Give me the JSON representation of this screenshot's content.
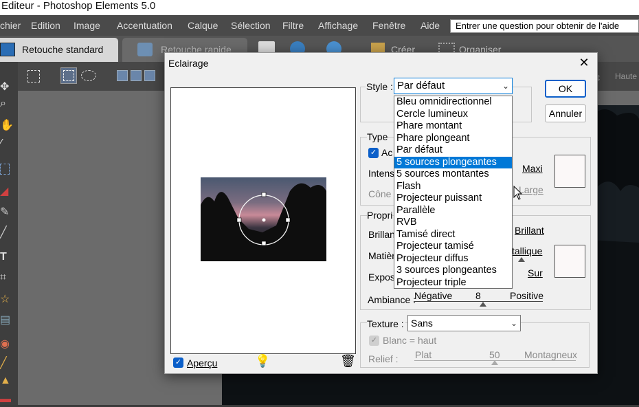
{
  "app": {
    "title": "Editeur - Photoshop Elements 5.0"
  },
  "menu": [
    "chier",
    "Edition",
    "Image",
    "Accentuation",
    "Calque",
    "Sélection",
    "Filtre",
    "Affichage",
    "Fenêtre",
    "Aide"
  ],
  "help_search": {
    "placeholder": "Entrer une question pour obtenir de l'aide"
  },
  "tabs": {
    "standard": "Retouche standard",
    "quick": "Retouche rapide"
  },
  "toolbar": {
    "create": "Créer",
    "organize": "Organiser"
  },
  "right_panel_label": "Haute",
  "dialog": {
    "title": "Eclairage",
    "close_glyph": "✕",
    "preview_label": "Aperçu",
    "preview_checked": true,
    "style_label": "Style :",
    "style_value": "Par défaut",
    "ok": "OK",
    "cancel": "Annuler",
    "type_group": "Type",
    "type_check_label": "Ac",
    "intensity_label": "Intens",
    "intensity_max": "Maxi",
    "cone_label": "Cône",
    "cone_max": "Large",
    "props_group": "Propri",
    "brillance_label": "Brillan",
    "brillance_max": "Brillant",
    "matiere_label": "Matièr",
    "matiere_max": "tallique",
    "expo_label": "Expos",
    "expo_max": "Sur",
    "ambiance_label": "Ambiance :",
    "ambiance_min": "Négative",
    "ambiance_value": "8",
    "ambiance_max": "Positive",
    "texture_label": "Texture :",
    "texture_value": "Sans",
    "blanc_label": "Blanc = haut",
    "relief_label": "Relief :",
    "relief_min": "Plat",
    "relief_value": "50",
    "relief_max": "Montagneux"
  },
  "style_options": [
    "Bleu omnidirectionnel",
    "Cercle lumineux",
    "Phare montant",
    "Phare plongeant",
    "Par défaut",
    "5 sources plongeantes",
    "5 sources montantes",
    "Flash",
    "Projecteur puissant",
    "Parallèle",
    "RVB",
    "Tamisé direct",
    "Projecteur tamisé",
    "Projecteur diffus",
    "3 sources plongeantes",
    "Projecteur triple"
  ],
  "selected_option_index": 5,
  "colors": {
    "accent": "#0078d7",
    "checkbox": "#0b5fc9",
    "menubar": "#4a4a4a"
  },
  "icons": [
    "close-icon",
    "bulb-icon",
    "trash-icon",
    "chevron-down-icon",
    "cursor-icon"
  ]
}
